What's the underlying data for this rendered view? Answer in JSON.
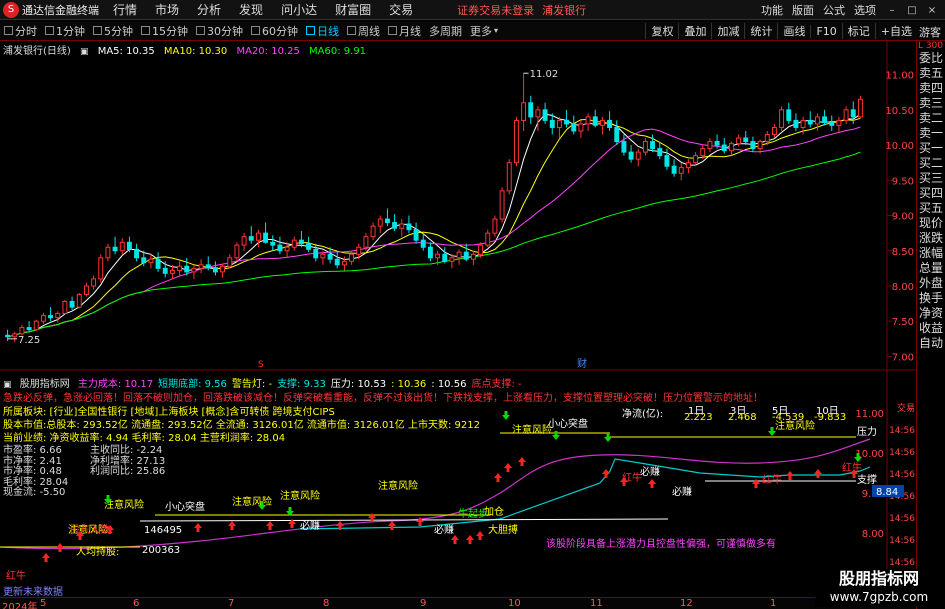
{
  "menubar": {
    "logo": "S",
    "app_title": "通达信金融终端",
    "items": [
      "行情",
      "市场",
      "分析",
      "发现",
      "问小达",
      "财富圈",
      "交易"
    ],
    "login_msg": "证券交易未登录",
    "bank": "浦发银行",
    "right_items": [
      "功能",
      "版面",
      "公式",
      "选项"
    ],
    "win_controls": [
      "–",
      "□",
      "×"
    ]
  },
  "periodbar": {
    "periods": [
      "分时",
      "1分钟",
      "5分钟",
      "15分钟",
      "30分钟",
      "60分钟",
      "日线",
      "周线",
      "月线",
      "多周期",
      "更多"
    ],
    "active": "日线",
    "right_buttons": [
      "复权",
      "叠加",
      "加减",
      "统计",
      "画线",
      "F10",
      "标记",
      "+自选"
    ],
    "guest": "游客"
  },
  "main_title": {
    "stock": "浦发银行(日线)",
    "ma5": "MA5: 10.35",
    "ma10": "MA10: 10.30",
    "ma20": "MA20: 10.25",
    "ma60": "MA60: 9.91"
  },
  "colors": {
    "up": "#ff3333",
    "down": "#00e5e5",
    "ma5": "#ffffff",
    "ma10": "#ffff00",
    "ma20": "#ff44ff",
    "ma60": "#00ff00",
    "panel_border": "#7a0000"
  },
  "chart_data": {
    "type": "candlestick",
    "y_ticks": [
      "11.00",
      "10.50",
      "10.00",
      "9.50",
      "9.00",
      "8.50",
      "8.00",
      "7.50",
      "7.00"
    ],
    "ylim": [
      6.85,
      11.25
    ],
    "high_label": "11.02",
    "low_label": "7.25",
    "marker_s": "S",
    "marker_cai": "财",
    "ohlc": [
      [
        7.3,
        7.38,
        7.22,
        7.28
      ],
      [
        7.28,
        7.35,
        7.2,
        7.32
      ],
      [
        7.32,
        7.45,
        7.3,
        7.41
      ],
      [
        7.41,
        7.5,
        7.35,
        7.38
      ],
      [
        7.38,
        7.52,
        7.36,
        7.5
      ],
      [
        7.5,
        7.62,
        7.46,
        7.58
      ],
      [
        7.58,
        7.7,
        7.5,
        7.55
      ],
      [
        7.55,
        7.64,
        7.48,
        7.61
      ],
      [
        7.61,
        7.8,
        7.6,
        7.78
      ],
      [
        7.78,
        7.85,
        7.66,
        7.7
      ],
      [
        7.7,
        7.9,
        7.68,
        7.88
      ],
      [
        7.88,
        8.05,
        7.85,
        8.0
      ],
      [
        8.0,
        8.15,
        7.95,
        8.1
      ],
      [
        8.1,
        8.45,
        8.05,
        8.4
      ],
      [
        8.4,
        8.6,
        8.35,
        8.55
      ],
      [
        8.55,
        8.7,
        8.45,
        8.5
      ],
      [
        8.5,
        8.68,
        8.45,
        8.62
      ],
      [
        8.62,
        8.7,
        8.48,
        8.52
      ],
      [
        8.52,
        8.6,
        8.35,
        8.4
      ],
      [
        8.4,
        8.5,
        8.28,
        8.33
      ],
      [
        8.33,
        8.45,
        8.25,
        8.38
      ],
      [
        8.38,
        8.48,
        8.2,
        8.25
      ],
      [
        8.25,
        8.35,
        8.12,
        8.18
      ],
      [
        8.18,
        8.3,
        8.1,
        8.22
      ],
      [
        8.22,
        8.35,
        8.15,
        8.28
      ],
      [
        8.28,
        8.4,
        8.15,
        8.2
      ],
      [
        8.2,
        8.3,
        8.1,
        8.25
      ],
      [
        8.25,
        8.38,
        8.18,
        8.3
      ],
      [
        8.3,
        8.42,
        8.22,
        8.26
      ],
      [
        8.26,
        8.35,
        8.15,
        8.2
      ],
      [
        8.2,
        8.32,
        8.12,
        8.28
      ],
      [
        8.28,
        8.45,
        8.25,
        8.4
      ],
      [
        8.4,
        8.62,
        8.35,
        8.58
      ],
      [
        8.58,
        8.75,
        8.5,
        8.7
      ],
      [
        8.7,
        8.85,
        8.6,
        8.65
      ],
      [
        8.65,
        8.8,
        8.55,
        8.75
      ],
      [
        8.75,
        8.9,
        8.6,
        8.62
      ],
      [
        8.62,
        8.72,
        8.5,
        8.58
      ],
      [
        8.58,
        8.7,
        8.45,
        8.5
      ],
      [
        8.5,
        8.62,
        8.4,
        8.55
      ],
      [
        8.55,
        8.7,
        8.5,
        8.65
      ],
      [
        8.65,
        8.78,
        8.55,
        8.6
      ],
      [
        8.6,
        8.7,
        8.48,
        8.52
      ],
      [
        8.52,
        8.6,
        8.35,
        8.4
      ],
      [
        8.4,
        8.5,
        8.3,
        8.45
      ],
      [
        8.45,
        8.55,
        8.32,
        8.38
      ],
      [
        8.38,
        8.48,
        8.25,
        8.3
      ],
      [
        8.3,
        8.42,
        8.22,
        8.35
      ],
      [
        8.35,
        8.5,
        8.3,
        8.45
      ],
      [
        8.45,
        8.6,
        8.38,
        8.55
      ],
      [
        8.55,
        8.75,
        8.5,
        8.7
      ],
      [
        8.7,
        8.9,
        8.65,
        8.85
      ],
      [
        8.85,
        9.0,
        8.75,
        8.95
      ],
      [
        8.95,
        9.1,
        8.85,
        8.9
      ],
      [
        8.9,
        9.02,
        8.78,
        8.82
      ],
      [
        8.82,
        8.95,
        8.7,
        8.88
      ],
      [
        8.88,
        9.0,
        8.75,
        8.8
      ],
      [
        8.8,
        8.9,
        8.6,
        8.65
      ],
      [
        8.65,
        8.75,
        8.5,
        8.55
      ],
      [
        8.55,
        8.62,
        8.35,
        8.4
      ],
      [
        8.4,
        8.5,
        8.3,
        8.45
      ],
      [
        8.45,
        8.55,
        8.32,
        8.35
      ],
      [
        8.35,
        8.45,
        8.25,
        8.4
      ],
      [
        8.4,
        8.52,
        8.3,
        8.48
      ],
      [
        8.48,
        8.6,
        8.35,
        8.38
      ],
      [
        8.38,
        8.5,
        8.3,
        8.45
      ],
      [
        8.45,
        8.62,
        8.4,
        8.58
      ],
      [
        8.58,
        8.8,
        8.55,
        8.75
      ],
      [
        8.75,
        9.0,
        8.7,
        8.95
      ],
      [
        8.95,
        9.4,
        8.9,
        9.35
      ],
      [
        9.35,
        9.8,
        9.3,
        9.75
      ],
      [
        9.75,
        10.4,
        9.7,
        10.35
      ],
      [
        10.35,
        11.02,
        10.2,
        10.6
      ],
      [
        10.6,
        10.7,
        10.3,
        10.4
      ],
      [
        10.4,
        10.55,
        10.2,
        10.5
      ],
      [
        10.5,
        10.6,
        10.3,
        10.35
      ],
      [
        10.35,
        10.45,
        10.15,
        10.25
      ],
      [
        10.25,
        10.4,
        10.1,
        10.35
      ],
      [
        10.35,
        10.5,
        10.25,
        10.3
      ],
      [
        10.3,
        10.42,
        10.15,
        10.2
      ],
      [
        10.2,
        10.35,
        10.1,
        10.3
      ],
      [
        10.3,
        10.45,
        10.2,
        10.4
      ],
      [
        10.4,
        10.5,
        10.25,
        10.28
      ],
      [
        10.28,
        10.4,
        10.15,
        10.35
      ],
      [
        10.35,
        10.48,
        10.2,
        10.25
      ],
      [
        10.25,
        10.35,
        10.0,
        10.05
      ],
      [
        10.05,
        10.15,
        9.85,
        9.9
      ],
      [
        9.9,
        10.0,
        9.75,
        9.8
      ],
      [
        9.8,
        9.95,
        9.7,
        9.9
      ],
      [
        9.9,
        10.1,
        9.85,
        10.05
      ],
      [
        10.05,
        10.15,
        9.9,
        9.95
      ],
      [
        9.95,
        10.05,
        9.8,
        9.85
      ],
      [
        9.85,
        9.95,
        9.65,
        9.7
      ],
      [
        9.7,
        9.8,
        9.55,
        9.6
      ],
      [
        9.6,
        9.75,
        9.5,
        9.68
      ],
      [
        9.68,
        9.8,
        9.6,
        9.75
      ],
      [
        9.75,
        9.9,
        9.7,
        9.85
      ],
      [
        9.85,
        10.0,
        9.8,
        9.95
      ],
      [
        9.95,
        10.1,
        9.9,
        10.05
      ],
      [
        10.05,
        10.15,
        9.95,
        10.0
      ],
      [
        10.0,
        10.1,
        9.88,
        9.92
      ],
      [
        9.92,
        10.05,
        9.85,
        10.02
      ],
      [
        10.02,
        10.15,
        9.98,
        10.1
      ],
      [
        10.1,
        10.2,
        10.0,
        10.05
      ],
      [
        10.05,
        10.12,
        9.9,
        9.95
      ],
      [
        9.95,
        10.08,
        9.88,
        10.05
      ],
      [
        10.05,
        10.2,
        10.0,
        10.15
      ],
      [
        10.15,
        10.3,
        10.1,
        10.25
      ],
      [
        10.25,
        10.55,
        10.2,
        10.5
      ],
      [
        10.5,
        10.6,
        10.3,
        10.35
      ],
      [
        10.35,
        10.45,
        10.2,
        10.25
      ],
      [
        10.25,
        10.4,
        10.15,
        10.35
      ],
      [
        10.35,
        10.48,
        10.25,
        10.3
      ],
      [
        10.3,
        10.45,
        10.2,
        10.4
      ],
      [
        10.4,
        10.5,
        10.28,
        10.32
      ],
      [
        10.32,
        10.42,
        10.2,
        10.28
      ],
      [
        10.28,
        10.4,
        10.18,
        10.35
      ],
      [
        10.35,
        10.55,
        10.3,
        10.5
      ],
      [
        10.5,
        10.62,
        10.3,
        10.4
      ],
      [
        10.4,
        10.7,
        10.38,
        10.65
      ]
    ]
  },
  "indicator": {
    "name": "股朋指标网",
    "items": [
      {
        "text": "主力成本: 10.17",
        "color": "#ff44ff"
      },
      {
        "text": "短期底部: 9.56",
        "color": "#00e5e5"
      },
      {
        "text": "警告灯: -",
        "color": "#ffff00"
      },
      {
        "text": "支撑: 9.33",
        "color": "#00e5e5"
      },
      {
        "text": "压力: 10.53",
        "color": "#ffffff"
      },
      {
        "text": ": 10.36",
        "color": "#ffff00"
      },
      {
        "text": ": 10.56",
        "color": "#ffffff"
      },
      {
        "text": "底点支撑: -",
        "color": "#ff3333"
      }
    ],
    "line2": "急跌必反弹，急涨必回落！回落不破则加仓，回落跌破该减仓！反弹突破看重能，反弹不过该出货！下跌找支撑，上涨看压力，支撑位置塑理必突破！压力位置警示的地址！",
    "sector": "所属板块: [行业]全国性银行 [地域]上海板块 [概念]含可转债 跨境支付CIPS",
    "capital": "股本市值:总股本: 293.52亿 流通盘: 293.52亿 全流通: 3126.01亿 流通市值: 3126.01亿 上市天数: 9212",
    "performance": "当前业绩: 净资收益率: 4.94 毛利率: 28.04 主营利润率: 28.04",
    "stats_left": [
      "市盈率: 6.66",
      "市净率: 2.41",
      "市净率: 0.48",
      "毛利率: 28.04",
      "现金流: -5.50"
    ],
    "stats_right": [
      "主收同比: -2.24",
      "净利增率: 27.13",
      "利润同比: 25.86"
    ],
    "flow_label": "净流(亿):",
    "flow_periods": [
      "1日",
      "3日",
      "5日",
      "10日"
    ],
    "flow_values": [
      "2.223",
      "2.468",
      "-4.539",
      "-9.833"
    ],
    "ylabels": [
      "11.00",
      "10.00",
      "9.00",
      "8.00"
    ],
    "right_ticks": [
      "交易",
      "14:56",
      "14:56",
      "14:56",
      "14:56",
      "14:56",
      "14:56",
      "14:56"
    ],
    "support_badge": "8.84",
    "labels": {
      "watch_risk": "注意风险",
      "careful": "小心突盘",
      "pressure": "压力",
      "support": "支撑",
      "add": "加仓",
      "bullish": "大胆搏",
      "must_earn": "必赚",
      "red_win": "红牛",
      "people": "146495",
      "people2": "200363",
      "hold_label": "人均持股:",
      "holders_label": "股东人数:",
      "note": "该股阶段具备上涨潜力且控盘性偏强，可谨慎做多有",
      "data_hint": "更新未来数据",
      "red_mark": "红牛"
    }
  },
  "right_panel": {
    "top": "L 300",
    "items": [
      "委比",
      "卖五",
      "卖四",
      "卖三",
      "卖二",
      "卖一",
      "买一",
      "买二",
      "买三",
      "买四",
      "买五",
      "现价",
      "涨跌",
      "涨幅",
      "总量",
      "外盘",
      "换手",
      "净资",
      "收益",
      "自动"
    ]
  },
  "bottom_axis": {
    "labels": [
      "2024年",
      "5",
      "6",
      "7",
      "8",
      "9",
      "10",
      "11",
      "12",
      "1"
    ]
  },
  "watermark": {
    "line1": "股朋指标网",
    "line2": "www.7gpzb.com"
  }
}
